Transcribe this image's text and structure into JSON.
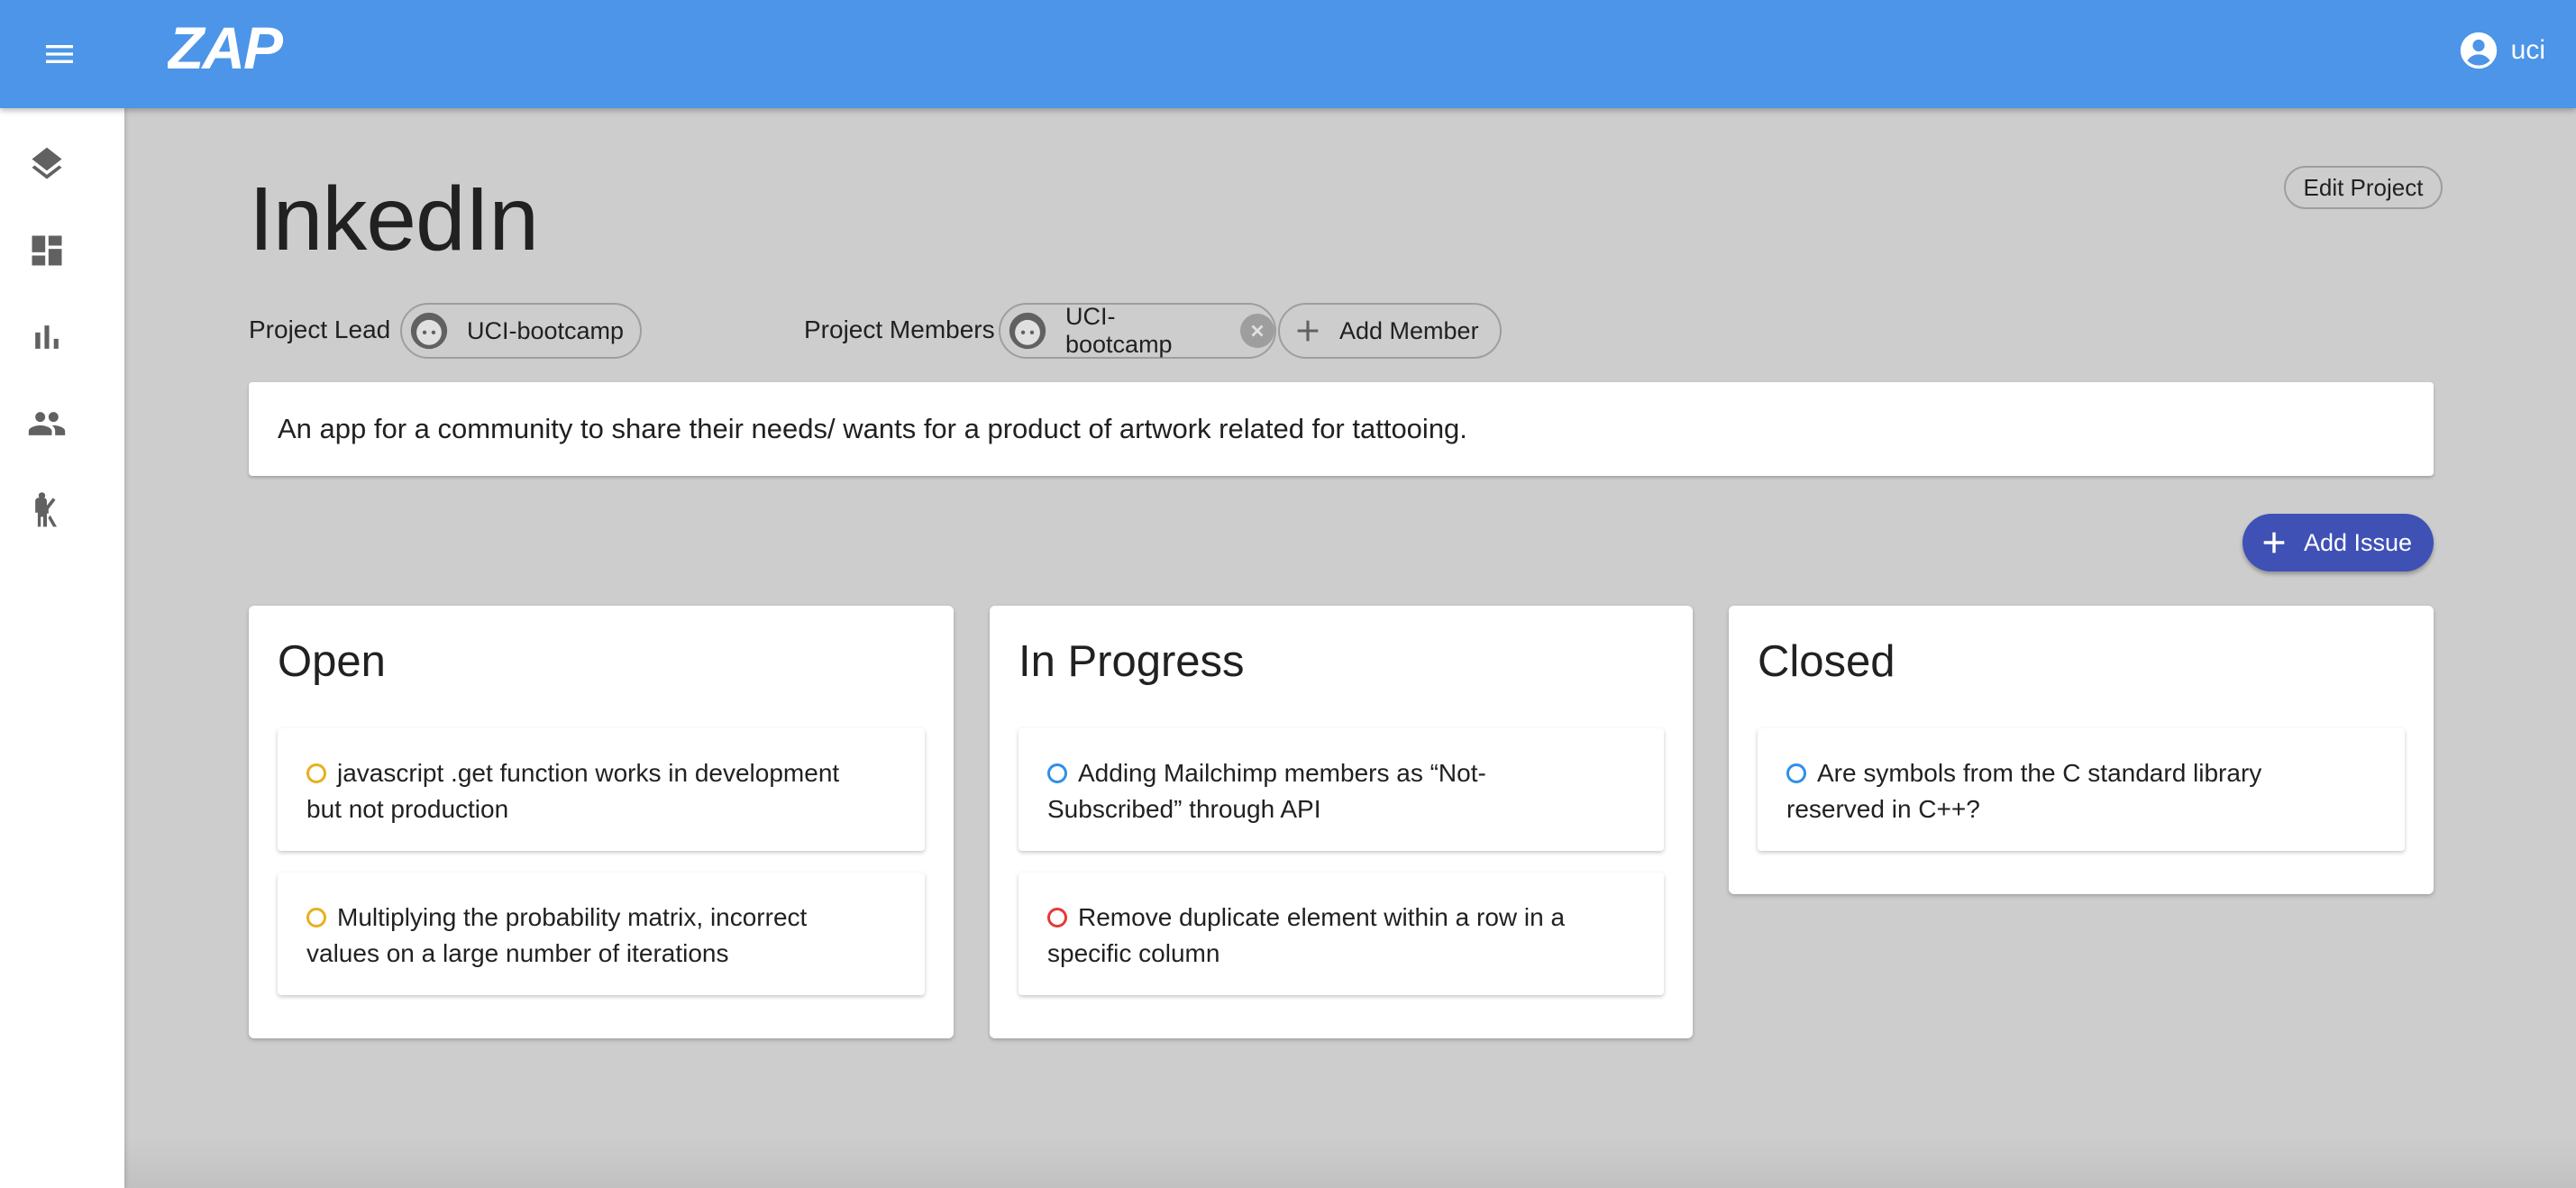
{
  "app": {
    "logo_text": "ZAP",
    "user_name": "uci",
    "colors": {
      "appbar": "#4c95e8",
      "primary_button": "#3f51b5",
      "background": "#cdcdcd"
    }
  },
  "sidebar": {
    "items": [
      {
        "icon": "layers-icon"
      },
      {
        "icon": "dashboard-icon"
      },
      {
        "icon": "bar-chart-icon"
      },
      {
        "icon": "people-icon"
      },
      {
        "icon": "accessibility-icon"
      }
    ]
  },
  "project": {
    "title": "InkedIn",
    "edit_label": "Edit Project",
    "lead_label": "Project Lead",
    "lead_name": "UCI-bootcamp",
    "members_label": "Project Members",
    "members": [
      "UCI-bootcamp"
    ],
    "add_member_label": "Add Member",
    "description": "An app for a community to share their needs/ wants for a product of artwork related for tattooing.",
    "add_issue_label": "Add Issue"
  },
  "columns": [
    {
      "title": "Open",
      "issues": [
        {
          "text": "javascript .get function works in development but not production",
          "status_color": "#e6b01e"
        },
        {
          "text": "Multiplying the probability matrix, incorrect values on a large number of iterations",
          "status_color": "#e6b01e"
        }
      ]
    },
    {
      "title": "In Progress",
      "issues": [
        {
          "text": "Adding Mailchimp members as “Not-Subscribed” through API",
          "status_color": "#2f8fe8"
        },
        {
          "text": "Remove duplicate element within a row in a specific column",
          "status_color": "#e53935"
        }
      ]
    },
    {
      "title": "Closed",
      "issues": [
        {
          "text": "Are symbols from the C standard library reserved in C++?",
          "status_color": "#2f8fe8"
        }
      ]
    }
  ]
}
